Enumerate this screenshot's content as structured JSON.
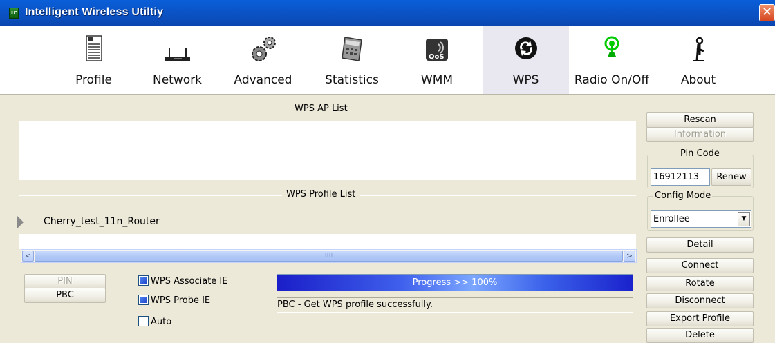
{
  "window": {
    "title": "Intelligent Wireless Utiltiy",
    "close": "✕"
  },
  "toolbar": {
    "items": [
      {
        "label": "Profile"
      },
      {
        "label": "Network"
      },
      {
        "label": "Advanced"
      },
      {
        "label": "Statistics"
      },
      {
        "label": "WMM"
      },
      {
        "label": "WPS"
      },
      {
        "label": "Radio On/Off"
      },
      {
        "label": "About"
      }
    ],
    "active": "WPS"
  },
  "wps_ap_list": {
    "title": "WPS AP List"
  },
  "wps_profile_list": {
    "title": "WPS Profile List",
    "profiles": [
      "Cherry_test_11n_Router"
    ]
  },
  "scrollbar": {
    "thumb_grip": "IIII",
    "left": "<",
    "right": ">"
  },
  "buttons": {
    "pin": "PIN",
    "pbc": "PBC",
    "rescan": "Rescan",
    "information": "Information",
    "renew": "Renew",
    "detail": "Detail",
    "connect": "Connect",
    "rotate": "Rotate",
    "disconnect": "Disconnect",
    "export_profile": "Export Profile",
    "delete": "Delete"
  },
  "options": {
    "wps_associate_ie": {
      "label": "WPS Associate IE",
      "checked": true
    },
    "wps_probe_ie": {
      "label": "WPS Probe IE",
      "checked": true
    },
    "auto": {
      "label": "Auto",
      "checked": false
    }
  },
  "progress": {
    "text": "Progress >> 100%",
    "value": 1.0
  },
  "status": "PBC - Get WPS profile successfully.",
  "pin_code": {
    "label": "Pin Code",
    "value": "16912113"
  },
  "config_mode": {
    "label": "Config Mode",
    "selected": "Enrollee"
  }
}
